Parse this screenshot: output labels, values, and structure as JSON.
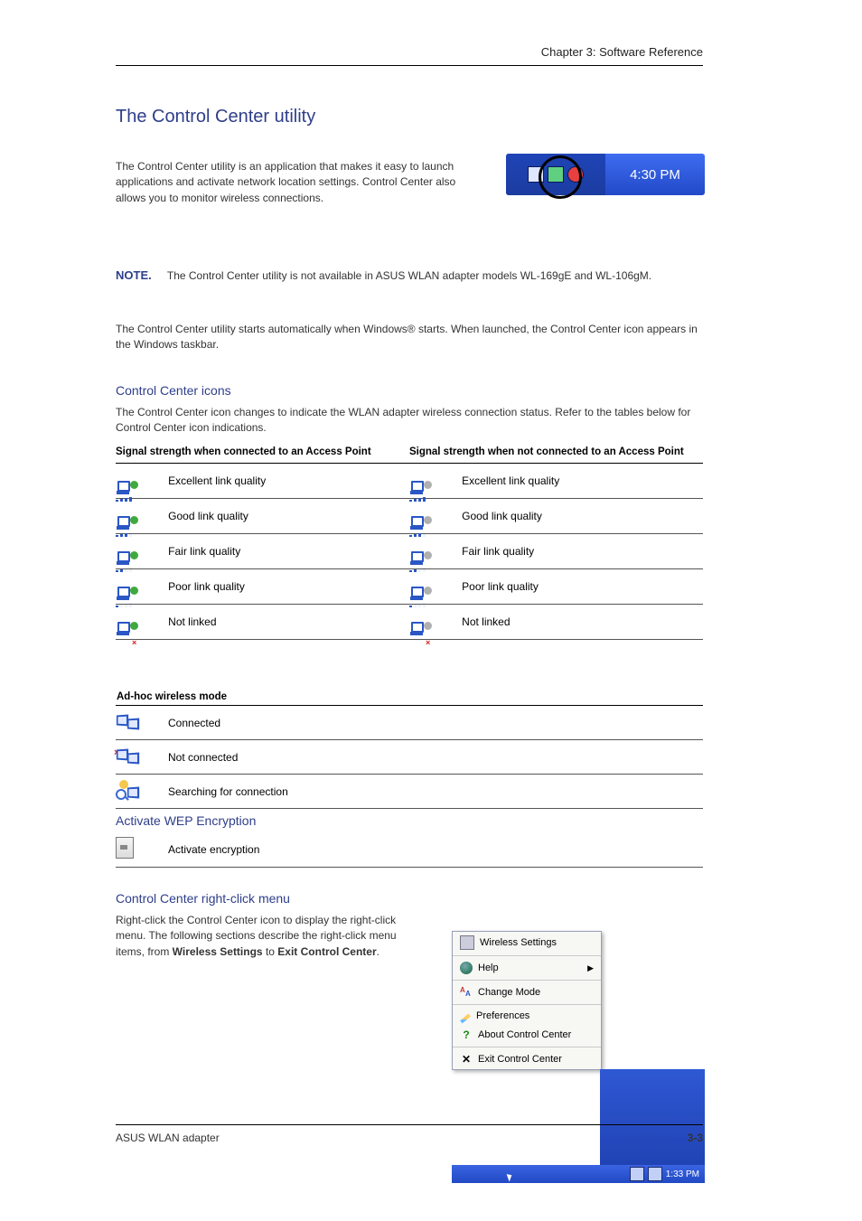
{
  "header": {
    "section": "Chapter 3: Software Reference"
  },
  "title": "The Control Center utility",
  "taskbar_time": "4:30 PM",
  "para1": "The Control Center utility is an application that makes it easy to launch applications and activate network location settings. Control Center also allows you to monitor wireless connections.",
  "note": {
    "label": "NOTE.",
    "text": "The Control Center utility is not available in ASUS WLAN adapter models WL-169gE and WL-106gM."
  },
  "para2_a": "The Control Center utility starts automatically when Windows",
  "para2_reg": "®",
  "para2_b": " starts. When launched, the Control Center icon appears in the Windows taskbar.",
  "icons_heading": "Control Center icons",
  "icons_para": "The Control Center icon changes to indicate the WLAN adapter wireless connection status. Refer to the tables below for Control Center icon indications.",
  "signal_table": {
    "head_left": "Signal strength when connected to an Access Point",
    "head_right": "Signal strength when not connected to an Access Point",
    "rows": [
      {
        "l": "Excellent link quality",
        "r": "Excellent link quality"
      },
      {
        "l": "Good link quality",
        "r": "Good link quality"
      },
      {
        "l": "Fair link quality",
        "r": "Fair link quality"
      },
      {
        "l": "Poor link quality",
        "r": "Poor link quality"
      },
      {
        "l": "Not linked",
        "r": "Not linked"
      }
    ]
  },
  "adhoc_table": {
    "head": "Ad-hoc wireless mode",
    "rows": [
      "Connected",
      "Not connected",
      "Searching for connection"
    ]
  },
  "wep_heading": "Activate WEP Encryption",
  "wep_row": "Activate encryption",
  "rc_heading": "Control Center right-click menu",
  "rc_para_a": "Right-click the Control Center icon to display the right-click menu. The following sections describe the right-click menu items, from ",
  "rc_para_b_bold": "Wireless Settings",
  "rc_para_c": " to ",
  "rc_para_d_bold": "Exit Control Center",
  "rc_para_e": ".",
  "context_menu": {
    "items": [
      {
        "label": "Wireless Settings",
        "icon": "ws",
        "arrow": false
      },
      {
        "label": "Help",
        "icon": "globe",
        "arrow": true
      },
      {
        "label": "Change Mode",
        "icon": "switch",
        "arrow": false
      },
      {
        "label": "Preferences",
        "icon": "pen",
        "arrow": false
      },
      {
        "label": "About Control Center",
        "icon": "q",
        "arrow": false
      },
      {
        "label": "Exit Control Center",
        "icon": "x",
        "arrow": false
      }
    ],
    "mini_taskbar_time": "1:33 PM"
  },
  "footer": {
    "text": "ASUS WLAN adapter",
    "page": "3-3"
  }
}
